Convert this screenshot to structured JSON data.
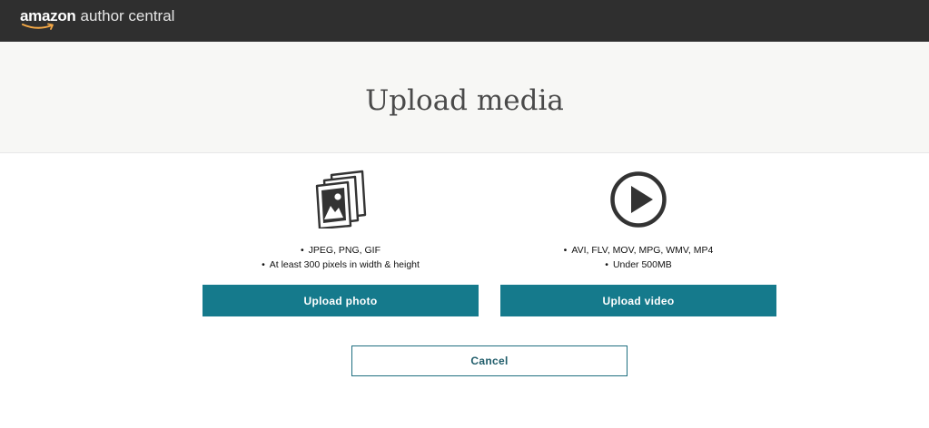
{
  "header": {
    "logo_brand": "amazon",
    "logo_product": "author central",
    "logo_icon": "amazon-smile-icon",
    "background": "#2f2f2f"
  },
  "hero": {
    "title": "Upload media",
    "background": "#f7f7f5"
  },
  "photo": {
    "icon": "photo-stack-icon",
    "requirements": [
      "JPEG, PNG, GIF",
      "At least 300 pixels in width & height"
    ],
    "button_label": "Upload photo"
  },
  "video": {
    "icon": "play-circle-icon",
    "requirements": [
      "AVI, FLV, MOV, MPG, WMV, MP4",
      "Under 500MB"
    ],
    "button_label": "Upload video"
  },
  "cancel": {
    "label": "Cancel"
  },
  "colors": {
    "primary_button": "#157a8c",
    "cancel_border": "#1f6f80",
    "icon_stroke": "#333333"
  }
}
